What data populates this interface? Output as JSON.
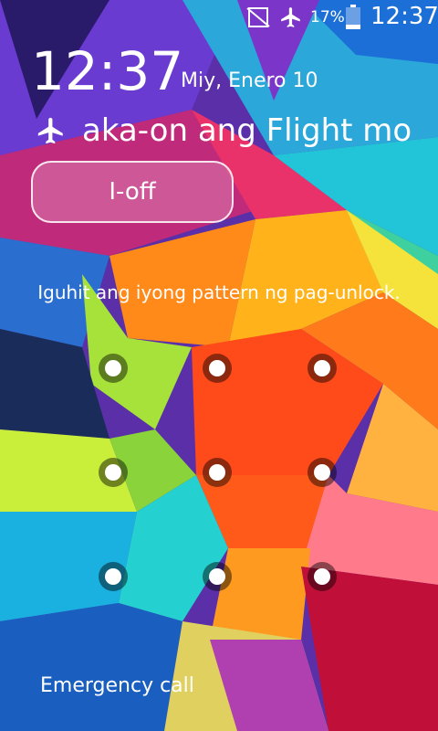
{
  "status_bar": {
    "battery_percent": "17%",
    "time": "12:37",
    "icons": [
      "no-sim-icon",
      "airplane-icon",
      "battery-icon"
    ]
  },
  "lock": {
    "time": "12:37",
    "date": "Miy, Enero 10",
    "flight_mode_text": "aka-on ang Flight mo",
    "off_button_label": "I-off",
    "pattern_hint": "Iguhit ang iyong pattern ng pag-unlock.",
    "emergency_call": "Emergency call"
  },
  "colors": {
    "text": "#ffffff",
    "dot_outer": "#000000",
    "dot_inner": "#ffffff"
  }
}
